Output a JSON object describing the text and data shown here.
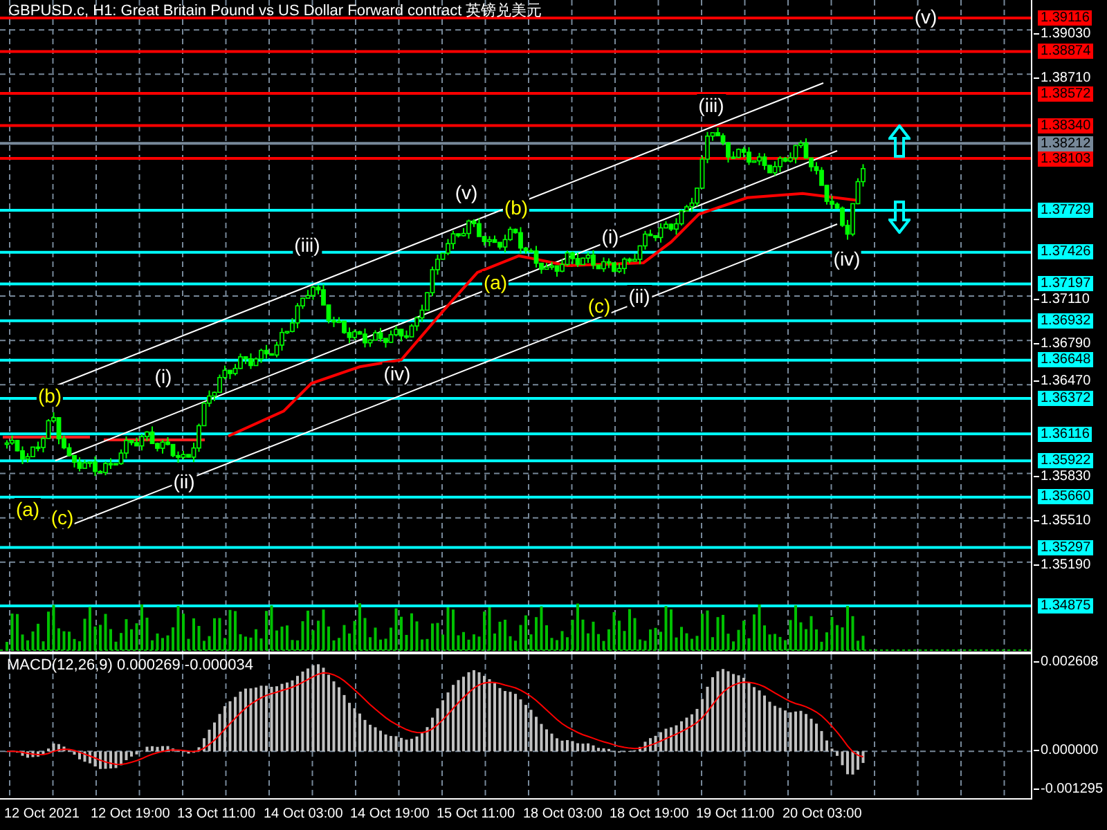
{
  "window": {
    "title": "GBPUSD.c, H1: Great Britain Pound vs US Dollar Forward contract 英镑兑美元"
  },
  "price_axis": {
    "ticks": [
      "1.39030",
      "1.38710",
      "1.37110",
      "1.36790",
      "1.36470",
      "1.35830",
      "1.35510",
      "1.35190"
    ]
  },
  "levels": [
    {
      "price": "1.39116",
      "color": "#ff0000"
    },
    {
      "price": "1.38874",
      "color": "#ff0000"
    },
    {
      "price": "1.38572",
      "color": "#ff0000"
    },
    {
      "price": "1.38340",
      "color": "#ff0000"
    },
    {
      "price": "1.38212",
      "color": "#778899"
    },
    {
      "price": "1.38103",
      "color": "#ff0000"
    },
    {
      "price": "1.37729",
      "color": "#00ffff"
    },
    {
      "price": "1.37426",
      "color": "#00ffff"
    },
    {
      "price": "1.37197",
      "color": "#00ffff"
    },
    {
      "price": "1.36932",
      "color": "#00ffff"
    },
    {
      "price": "1.36648",
      "color": "#00ffff"
    },
    {
      "price": "1.36372",
      "color": "#00ffff"
    },
    {
      "price": "1.36116",
      "color": "#00ffff"
    },
    {
      "price": "1.35922",
      "color": "#00ffff"
    },
    {
      "price": "1.35660",
      "color": "#00ffff"
    },
    {
      "price": "1.35297",
      "color": "#00ffff"
    },
    {
      "price": "1.34875",
      "color": "#00ffff"
    }
  ],
  "wave_labels": [
    {
      "text": "(a)",
      "color": "#ffff00"
    },
    {
      "text": "(c)",
      "color": "#ffff00"
    },
    {
      "text": "(b)",
      "color": "#ffff00"
    },
    {
      "text": "(i)",
      "color": "#ffffff"
    },
    {
      "text": "(ii)",
      "color": "#ffffff"
    },
    {
      "text": "(iii)",
      "color": "#ffffff"
    },
    {
      "text": "(iv)",
      "color": "#ffffff"
    },
    {
      "text": "(v)",
      "color": "#ffffff"
    },
    {
      "text": "(b)",
      "color": "#ffff00"
    },
    {
      "text": "(a)",
      "color": "#ffff00"
    },
    {
      "text": "(i)",
      "color": "#ffffff"
    },
    {
      "text": "(c)",
      "color": "#ffff00"
    },
    {
      "text": "(ii)",
      "color": "#ffffff"
    },
    {
      "text": "(iii)",
      "color": "#ffffff"
    },
    {
      "text": "(iv)",
      "color": "#ffffff"
    },
    {
      "text": "(v)",
      "color": "#ffffff"
    }
  ],
  "macd": {
    "label": "MACD(12,26,9) 0.000269 -0.000034",
    "ticks": [
      "0.002608",
      "0.000000",
      "-0.001295"
    ]
  },
  "time_axis": {
    "labels": [
      "12 Oct 2021",
      "12 Oct 19:00",
      "13 Oct 11:00",
      "14 Oct 03:00",
      "14 Oct 19:00",
      "15 Oct 11:00",
      "18 Oct 03:00",
      "18 Oct 19:00",
      "19 Oct 11:00",
      "20 Oct 03:00"
    ]
  }
}
